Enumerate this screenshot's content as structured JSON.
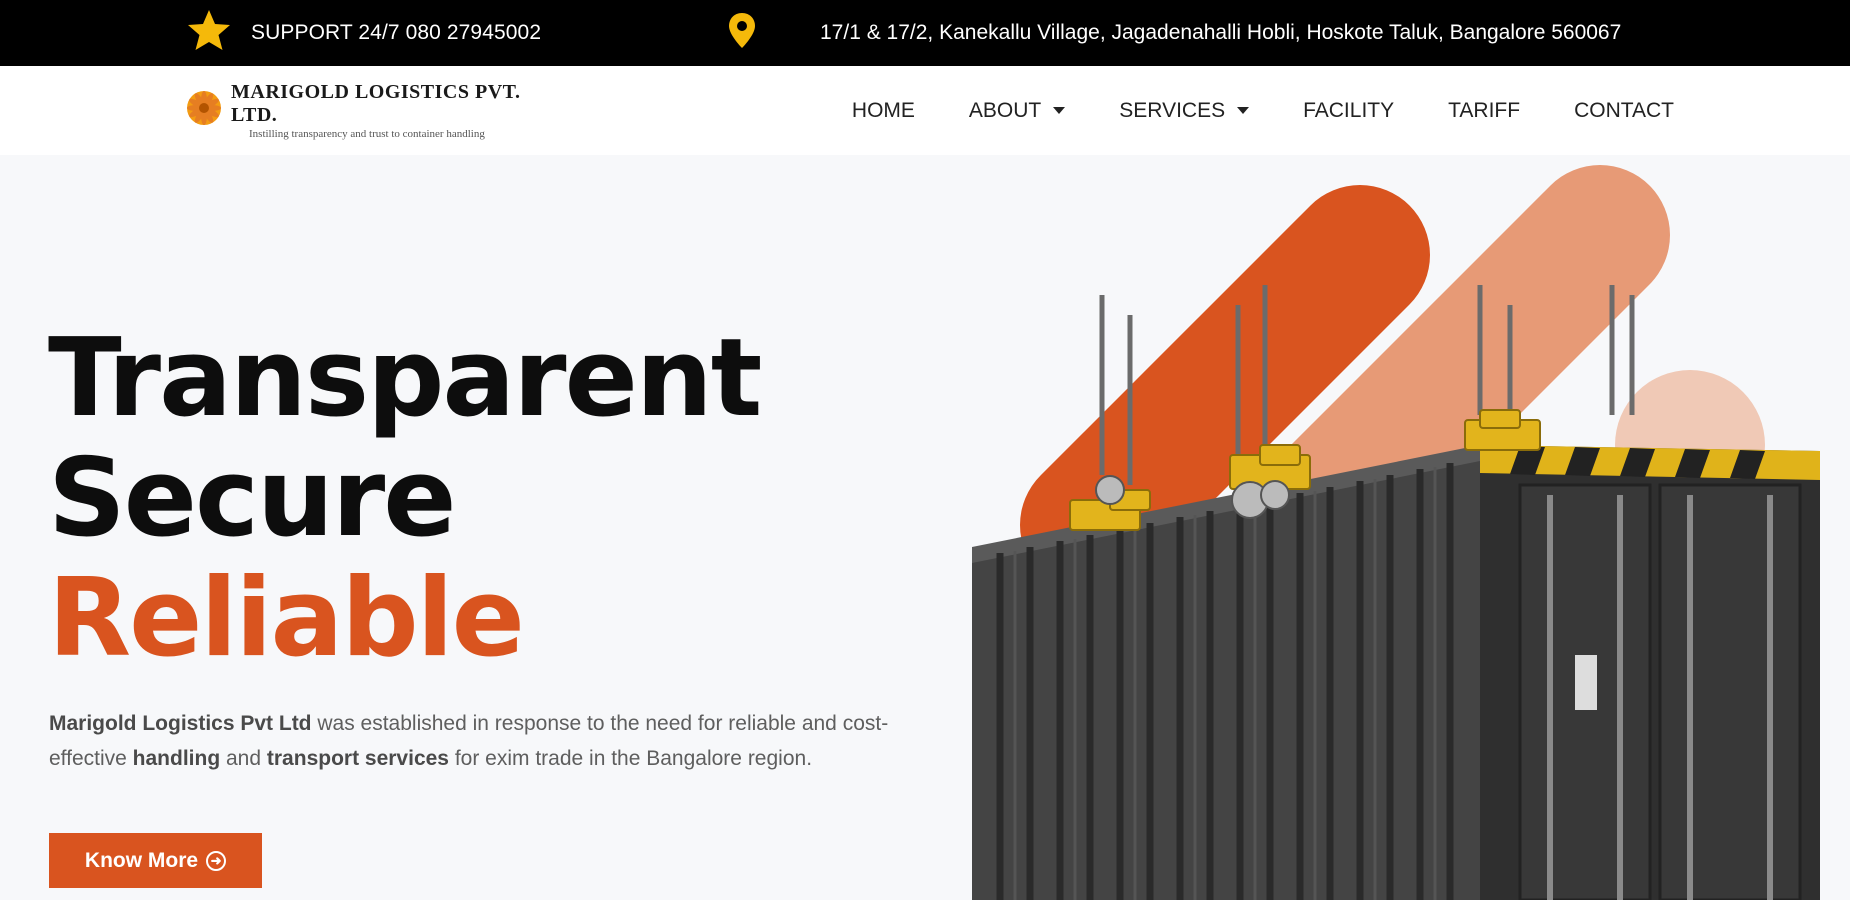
{
  "topbar": {
    "support_icon": "star-icon",
    "support_text": "SUPPORT 24/7 080 27945002",
    "location_icon": "map-pin-icon",
    "address": "17/1 & 17/2, Kanekallu Village, Jagadenahalli Hobli, Hoskote Taluk, Bangalore 560067"
  },
  "brand": {
    "name": "MARIGOLD LOGISTICS PVT. LTD.",
    "tagline": "Instilling transparency and trust to container handling"
  },
  "nav": {
    "items": [
      {
        "label": "HOME"
      },
      {
        "label": "ABOUT"
      },
      {
        "label": "SERVICES"
      },
      {
        "label": "FACILITY"
      },
      {
        "label": "TARIFF"
      },
      {
        "label": "CONTACT"
      }
    ]
  },
  "hero": {
    "line1": "Transparent",
    "line2": "Secure",
    "line3": "Reliable",
    "desc_company": "Marigold Logistics Pvt Ltd",
    "desc_part1": " was established in response to the need for reliable and cost-effective ",
    "desc_handling": "handling",
    "desc_and": " and ",
    "desc_transport": "transport services",
    "desc_part2": " for exim trade in the Bangalore region.",
    "cta_label": "Know More",
    "cta_icon": "arrow-right-circle-icon",
    "image": "shipping-container-illustration"
  },
  "colors": {
    "accent": "#d9541f",
    "accent_light": "#e79a76",
    "accent_pale": "#f0c9b6",
    "topbar_bg": "#000000",
    "icon_yellow": "#f5b90a"
  }
}
